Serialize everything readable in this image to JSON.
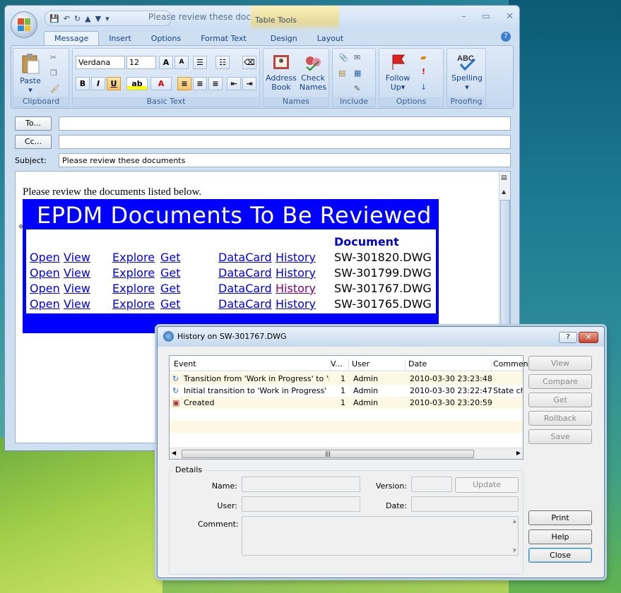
{
  "window": {
    "title": "Please review these doc...",
    "context_tab": "Table Tools"
  },
  "ribbon": {
    "tabs": [
      "Message",
      "Insert",
      "Options",
      "Format Text",
      "Design",
      "Layout"
    ],
    "font_name": "Verdana",
    "font_size": "12",
    "groups": {
      "clipboard": "Clipboard",
      "basic_text": "Basic Text",
      "names": "Names",
      "include": "Include",
      "options": "Options",
      "proofing": "Proofing"
    },
    "buttons": {
      "paste": "Paste",
      "address_book_1": "Address",
      "address_book_2": "Book",
      "check_names_1": "Check",
      "check_names_2": "Names",
      "follow_up_1": "Follow",
      "follow_up_2": "Up",
      "spelling": "Spelling"
    }
  },
  "header": {
    "to_button": "To...",
    "cc_button": "Cc...",
    "subject_label": "Subject:",
    "subject_value": "Please review these documents",
    "to_value": "",
    "cc_value": ""
  },
  "message": {
    "intro": "Please review the documents listed below.",
    "banner": "EPDM Documents To Be Reviewed",
    "doc_header": "Document",
    "rows": [
      {
        "open": "Open",
        "view": "View",
        "explore": "Explore",
        "get": "Get",
        "datacard": "DataCard",
        "history": "History",
        "file": "SW-301820.DWG"
      },
      {
        "open": "Open",
        "view": "View",
        "explore": "Explore",
        "get": "Get",
        "datacard": "DataCard",
        "history": "History",
        "file": "SW-301799.DWG"
      },
      {
        "open": "Open",
        "view": "View",
        "explore": "Explore",
        "get": "Get",
        "datacard": "DataCard",
        "history": "History",
        "file": "SW-301767.DWG"
      },
      {
        "open": "Open",
        "view": "View",
        "explore": "Explore",
        "get": "Get",
        "datacard": "DataCard",
        "history": "History",
        "file": "SW-301765.DWG"
      }
    ]
  },
  "dialog": {
    "title": "History on SW-301767.DWG",
    "help_btn": "?",
    "close_btn": "✕",
    "columns": [
      "Event",
      "V...",
      "User",
      "Date",
      "Commen"
    ],
    "rows": [
      {
        "event": "Transition from 'Work in Progress' to 'P...",
        "version": "1",
        "user": "Admin",
        "date": "2010-03-30 23:23:48",
        "comment": ""
      },
      {
        "event": "Initial transition to 'Work in Progress'",
        "version": "1",
        "user": "Admin",
        "date": "2010-03-30 23:22:47",
        "comment": "State ch"
      },
      {
        "event": "Created",
        "version": "1",
        "user": "Admin",
        "date": "2010-03-30 23:20:59",
        "comment": ""
      }
    ],
    "buttons": {
      "view": "View",
      "compare": "Compare",
      "get": "Get",
      "rollback": "Rollback",
      "save": "Save",
      "print": "Print",
      "help": "Help",
      "close": "Close"
    },
    "details": {
      "legend": "Details",
      "name_label": "Name:",
      "version_label": "Version:",
      "update": "Update",
      "user_label": "User:",
      "date_label": "Date:",
      "comment_label": "Comment:"
    }
  }
}
